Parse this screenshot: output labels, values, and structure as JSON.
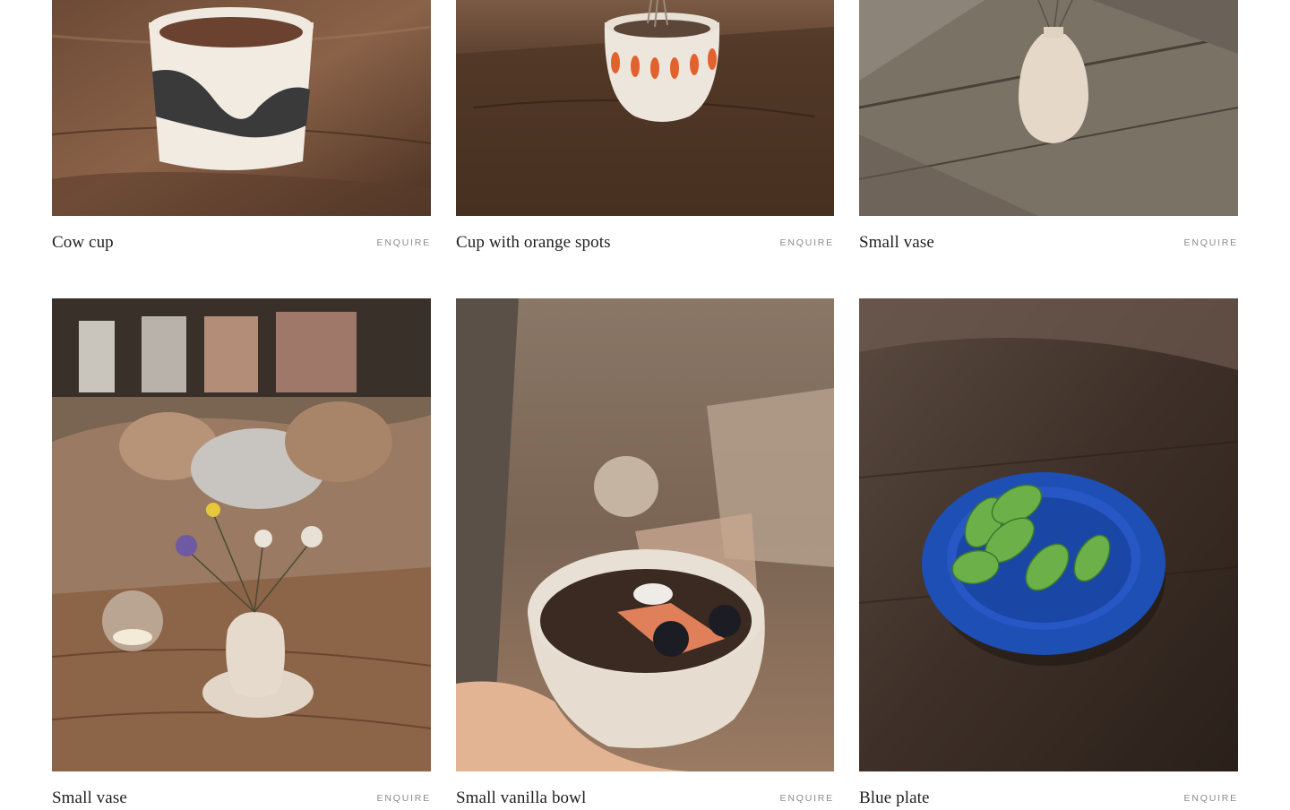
{
  "products": [
    {
      "title": "Cow cup",
      "action": "ENQUIRE",
      "photo_subject": "speckled-cup-with-black-patches-on-wood"
    },
    {
      "title": "Cup with orange spots",
      "action": "ENQUIRE",
      "photo_subject": "white-cup-with-orange-strokes-and-dried-flowers"
    },
    {
      "title": "Small vase",
      "action": "ENQUIRE",
      "photo_subject": "beige-bud-vase-on-grey-planks"
    },
    {
      "title": "Small vase",
      "action": "ENQUIRE",
      "photo_subject": "bud-vase-with-wildflowers-and-candle"
    },
    {
      "title": "Small vanilla bowl",
      "action": "ENQUIRE",
      "photo_subject": "speckled-bowl-held-in-hand"
    },
    {
      "title": "Blue plate",
      "action": "ENQUIRE",
      "photo_subject": "blue-plate-with-mini-melons"
    }
  ],
  "colors": {
    "text": "#1f1f1f",
    "muted": "#8a8a8a",
    "background": "#ffffff",
    "plate_blue": "#1d4fb5"
  }
}
